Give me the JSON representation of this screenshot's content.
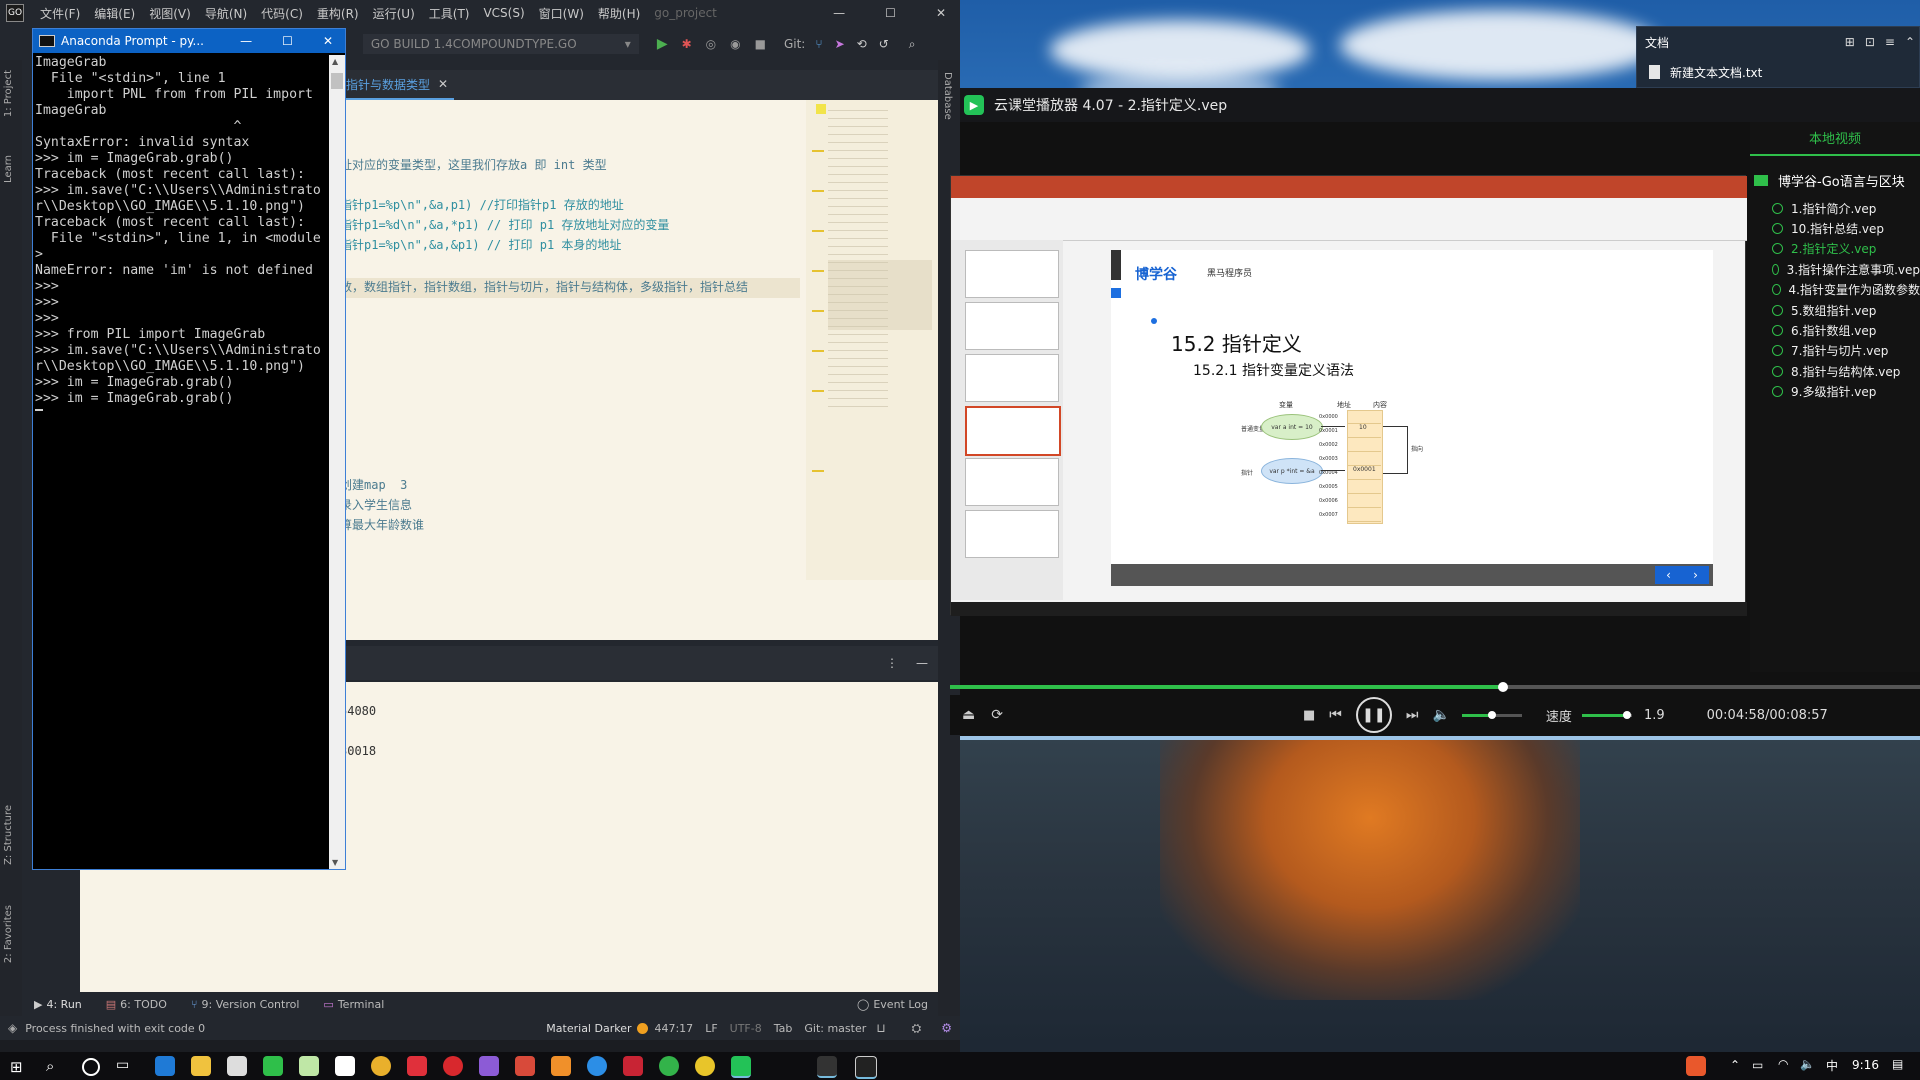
{
  "ide": {
    "menu": [
      "文件(F)",
      "编辑(E)",
      "视图(V)",
      "导航(N)",
      "代码(C)",
      "重构(R)",
      "运行(U)",
      "工具(T)",
      "VCS(S)",
      "窗口(W)",
      "帮助(H)",
      "go_project"
    ],
    "run_config": "GO BUILD 1.4COMPOUNDTYPE.GO",
    "git_label": "Git:",
    "editor_tab": "指针与数据类型",
    "code_lines": [
      "址对应的变量类型，这里我们存放a 即 int 类型",
      "指针p1=%p\\n\",&a,p1) //打印指针p1 存放的地址",
      "指针p1=%d\\n\",&a,*p1) // 打印 p1 存放地址对应的变量",
      "指针p1=%p\\n\",&a,&p1) // 打印 p1 本身的地址",
      "数，数组指针，指针数组，指针与切片，指针与结构体，多级指针，指针总结",
      "创建map  3",
      "录入学生信息",
      "算最大年龄数谁"
    ],
    "run_output": [
      "54080",
      "30018"
    ],
    "left_tools": [
      "1: Project",
      "Learn",
      "Z: Structure",
      "2: Favorites"
    ],
    "right_tools": [
      "Database"
    ],
    "bottom_tabs": [
      "4: Run",
      "6: TODO",
      "9: Version Control",
      "Terminal"
    ],
    "event_log": "Event Log",
    "status": {
      "message": "Process finished with exit code 0",
      "theme": "Material Darker",
      "position": "447:17",
      "line_sep": "LF",
      "encoding": "UTF-8",
      "indent": "Tab",
      "git": "Git: master"
    }
  },
  "conda": {
    "title": "Anaconda Prompt - py...",
    "lines": [
      "ImageGrab",
      "  File \"<stdin>\", line 1",
      "    import PNL from from PIL import",
      "ImageGrab",
      "                         ^",
      "SyntaxError: invalid syntax",
      ">>> im = ImageGrab.grab()",
      "Traceback (most recent call last):",
      ">>> im.save(\"C:\\\\Users\\\\Administrato",
      "r\\\\Desktop\\\\GO_IMAGE\\\\5.1.10.png\")",
      "Traceback (most recent call last):",
      "  File \"<stdin>\", line 1, in <module",
      ">",
      "NameError: name 'im' is not defined",
      ">>>",
      ">>>",
      ">>>",
      ">>> from PIL import ImageGrab",
      ">>> im.save(\"C:\\\\Users\\\\Administrato",
      "r\\\\Desktop\\\\GO_IMAGE\\\\5.1.10.png\")",
      ">>> im = ImageGrab.grab()",
      ">>> im = ImageGrab.grab()"
    ]
  },
  "explorer": {
    "title": "文档",
    "file": "新建文本文档.txt"
  },
  "player": {
    "title": "云课堂播放器 4.07 - 2.指针定义.vep",
    "sidebar_tab": "本地视频",
    "folder": "博学谷-Go语言与区块",
    "playlist": [
      "1.指针简介.vep",
      "10.指针总结.vep",
      "2.指针定义.vep",
      "3.指针操作注意事项.vep",
      "4.指针变量作为函数参数",
      "5.数组指针.vep",
      "6.指针数组.vep",
      "7.指针与切片.vep",
      "8.指针与结构体.vep",
      "9.多级指针.vep"
    ],
    "active_index": 2,
    "progress": 0.57,
    "volume": 0.5,
    "speed_label": "速度",
    "speed_value": "1.9",
    "speed_level": 0.9,
    "time": "00:04:58/00:08:57",
    "slide": {
      "logo": "博学谷",
      "logo2": "黑马程序员",
      "heading": "15.2 指针定义",
      "subheading": "15.2.1 指针变量定义语法",
      "col_var": "变量",
      "col_addr": "地址",
      "col_content": "内容",
      "node1_label": "普通变量",
      "node1": "var a int = 10",
      "node2_label": "指针",
      "node2": "var p *int = &a",
      "addresses": [
        "0x0000",
        "0x0001",
        "0x0002",
        "0x0003",
        "0x0004",
        "0x0005",
        "0x0006",
        "0x0007"
      ],
      "cell_value": "10",
      "cell_ptr": "0x0001",
      "arrow_label": "指向"
    }
  },
  "taskbar": {
    "time": "9:16"
  },
  "colors": {
    "accent_green": "#2fbf4a",
    "conda_blue": "#0c62c4",
    "ppt_orange": "#d24726"
  }
}
